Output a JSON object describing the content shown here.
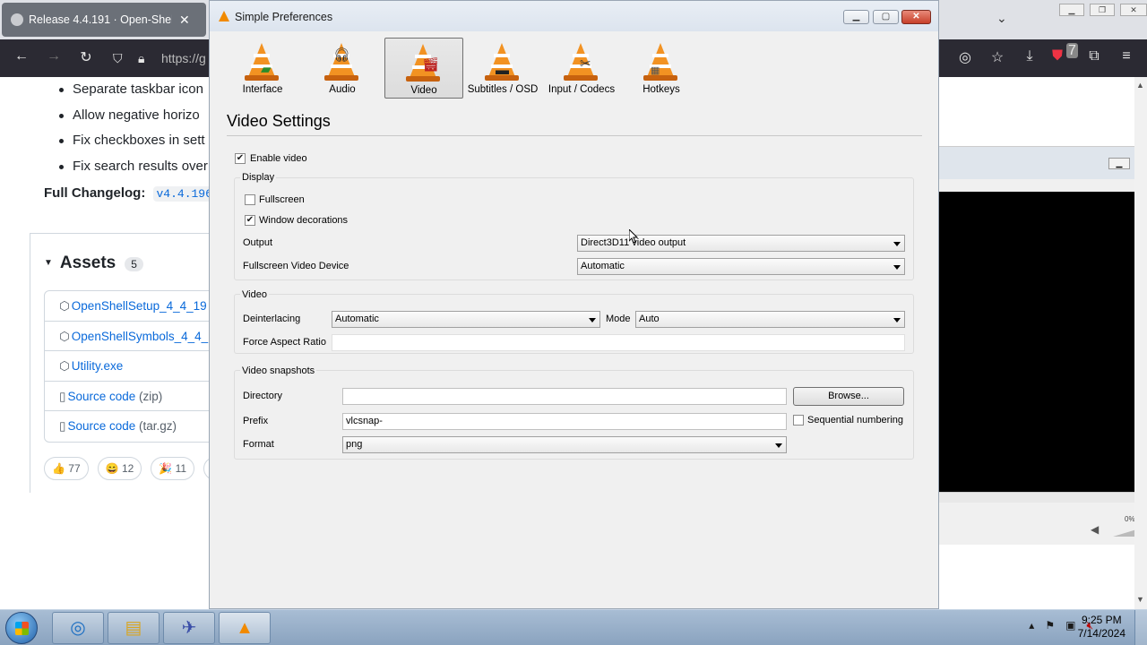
{
  "browser": {
    "tab_title": "Release 4.4.191 · Open-Shell/Op",
    "tab_close": "✕",
    "url_partial": "https://g",
    "ext_badge": "7"
  },
  "page": {
    "bullets": [
      "Separate taskbar icon",
      "Allow negative horizo",
      "Fix checkboxes in sett",
      "Fix search results over"
    ],
    "changelog_label": "Full Changelog:",
    "changelog_code": "v4.4.196",
    "assets_title": "Assets",
    "assets_count": "5",
    "assets": [
      {
        "name": "OpenShellSetup_4_4_19",
        "ext": ""
      },
      {
        "name": "OpenShellSymbols_4_4_",
        "ext": ""
      },
      {
        "name": "Utility.exe",
        "ext": ""
      },
      {
        "name": "Source code",
        "ext": "(zip)"
      },
      {
        "name": "Source code",
        "ext": "(tar.gz)"
      }
    ],
    "reactions": [
      {
        "emoji": "👍",
        "count": "77"
      },
      {
        "emoji": "😄",
        "count": "12"
      },
      {
        "emoji": "🎉",
        "count": "11"
      },
      {
        "emoji": "❤",
        "count": ""
      }
    ]
  },
  "vlc_main": {
    "volume_pct": "0%"
  },
  "dialog": {
    "title": "Simple Preferences",
    "categories": [
      {
        "label": "Interface",
        "icon": "interface-icon",
        "active": false
      },
      {
        "label": "Audio",
        "icon": "audio-icon",
        "active": false
      },
      {
        "label": "Video",
        "icon": "video-icon",
        "active": true
      },
      {
        "label": "Subtitles / OSD",
        "icon": "subtitles-icon",
        "active": false
      },
      {
        "label": "Input / Codecs",
        "icon": "codecs-icon",
        "active": false
      },
      {
        "label": "Hotkeys",
        "icon": "hotkeys-icon",
        "active": false
      }
    ],
    "section_title": "Video Settings",
    "enable_video": {
      "label": "Enable video",
      "checked": true
    },
    "display": {
      "group_title": "Display",
      "fullscreen": {
        "label": "Fullscreen",
        "checked": false
      },
      "window_decorations": {
        "label": "Window decorations",
        "checked": true
      },
      "output_label": "Output",
      "output_value": "Direct3D11 video output",
      "fs_device_label": "Fullscreen Video Device",
      "fs_device_value": "Automatic"
    },
    "video": {
      "group_title": "Video",
      "deinterlacing_label": "Deinterlacing",
      "deinterlacing_value": "Automatic",
      "mode_label": "Mode",
      "mode_value": "Auto",
      "aspect_label": "Force Aspect Ratio",
      "aspect_value": ""
    },
    "snapshots": {
      "group_title": "Video snapshots",
      "directory_label": "Directory",
      "directory_value": "",
      "browse_label": "Browse...",
      "prefix_label": "Prefix",
      "prefix_value": "vlcsnap-",
      "sequential": {
        "label": "Sequential numbering",
        "checked": false
      },
      "format_label": "Format",
      "format_value": "png"
    }
  },
  "taskbar": {
    "time": "9:25 PM",
    "date": "7/14/2024"
  },
  "colors": {
    "vlc_orange": "#f29222",
    "link_blue": "#0969da"
  }
}
